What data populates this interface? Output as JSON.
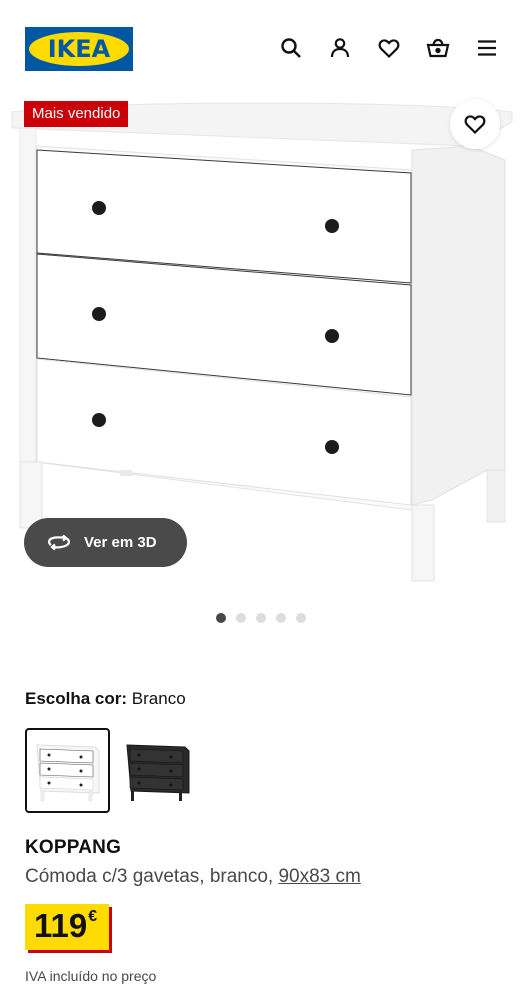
{
  "header": {
    "logo_text": "IKEA",
    "icons": [
      "search-icon",
      "user-icon",
      "heart-icon",
      "basket-icon",
      "menu-icon"
    ]
  },
  "product_image": {
    "badge": "Mais vendido",
    "view_3d_label": "Ver em 3D",
    "carousel": {
      "total": 5,
      "active": 1
    }
  },
  "color_choice": {
    "label": "Escolha cor:",
    "value": "Branco",
    "options": [
      {
        "name": "white",
        "selected": true
      },
      {
        "name": "black-brown",
        "selected": false
      }
    ]
  },
  "product": {
    "name": "KOPPANG",
    "description": "Cómoda c/3 gavetas, branco,",
    "dimensions": "90x83 cm",
    "price": "119",
    "currency": "€",
    "vat_note": "IVA incluído no preço"
  },
  "colors": {
    "ikea_blue": "#0058a3",
    "ikea_yellow": "#ffdb00",
    "badge_red": "#cc0008",
    "dark_button": "#4a4a4a"
  }
}
